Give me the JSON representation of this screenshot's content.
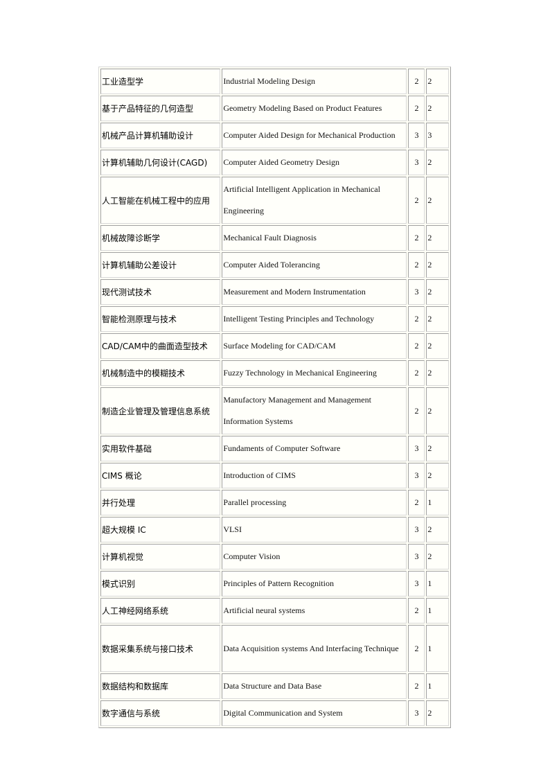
{
  "table": {
    "rows": [
      {
        "cn": "工业造型学",
        "en": "Industrial Modeling Design",
        "credits": "2",
        "hours": "2",
        "lines": 1
      },
      {
        "cn": "基于产品特征的几何造型",
        "en": "Geometry Modeling Based on Product Features",
        "credits": "2",
        "hours": "2",
        "lines": 1
      },
      {
        "cn": "机械产品计算机辅助设计",
        "en": "Computer Aided Design for Mechanical Production",
        "credits": "3",
        "hours": "3",
        "lines": 1
      },
      {
        "cn": "计算机辅助几何设计(CAGD)",
        "en": "Computer Aided Geometry Design",
        "credits": "3",
        "hours": "2",
        "lines": 1
      },
      {
        "cn": "人工智能在机械工程中的应用",
        "en": "Artificial Intelligent Application in Mechanical Engineering",
        "credits": "2",
        "hours": "2",
        "lines": 2
      },
      {
        "cn": "机械故障诊断学",
        "en": "Mechanical Fault Diagnosis",
        "credits": "2",
        "hours": "2",
        "lines": 1
      },
      {
        "cn": "计算机辅助公差设计",
        "en": "Computer Aided Tolerancing",
        "credits": "2",
        "hours": "2",
        "lines": 1
      },
      {
        "cn": "现代测试技术",
        "en": "Measurement and Modern Instrumentation",
        "credits": "3",
        "hours": "2",
        "lines": 1
      },
      {
        "cn": "智能检测原理与技术",
        "en": "Intelligent Testing Principles and Technology",
        "credits": "2",
        "hours": "2",
        "lines": 1
      },
      {
        "cn": "CAD/CAM中的曲面造型技术",
        "en": "Surface Modeling for CAD/CAM",
        "credits": "2",
        "hours": "2",
        "lines": 1
      },
      {
        "cn": "机械制造中的模糊技术",
        "en": "Fuzzy Technology in Mechanical Engineering",
        "credits": "2",
        "hours": "2",
        "lines": 1
      },
      {
        "cn": "制造企业管理及管理信息系统",
        "en": "Manufactory Management and Management Information Systems",
        "credits": "2",
        "hours": "2",
        "lines": 2
      },
      {
        "cn": "实用软件基础",
        "en": "Fundaments of Computer Software",
        "credits": "3",
        "hours": "2",
        "lines": 1
      },
      {
        "cn": "CIMS 概论",
        "en": "Introduction of CIMS",
        "credits": "3",
        "hours": "2",
        "lines": 1
      },
      {
        "cn": "并行处理",
        "en": "Parallel processing",
        "credits": "2",
        "hours": "1",
        "lines": 1
      },
      {
        "cn": "超大规模 IC",
        "en": "VLSI",
        "credits": "3",
        "hours": "2",
        "lines": 1
      },
      {
        "cn": "计算机视觉",
        "en": "Computer Vision",
        "credits": "3",
        "hours": "2",
        "lines": 1
      },
      {
        "cn": "模式识别",
        "en": "Principles of Pattern Recognition",
        "credits": "3",
        "hours": "1",
        "lines": 1
      },
      {
        "cn": "人工神经网络系统",
        "en": "Artificial neural systems",
        "credits": "2",
        "hours": "1",
        "lines": 1
      },
      {
        "cn": "数据采集系统与接口技术",
        "en": "Data Acquisition systems And Interfacing Technique",
        "credits": "2",
        "hours": "1",
        "lines": 2
      },
      {
        "cn": "数据结构和数据库",
        "en": "Data Structure and Data Base",
        "credits": "2",
        "hours": "1",
        "lines": 1
      },
      {
        "cn": "数字通信与系统",
        "en": "Digital Communication and System",
        "credits": "3",
        "hours": "2",
        "lines": 1
      }
    ]
  }
}
